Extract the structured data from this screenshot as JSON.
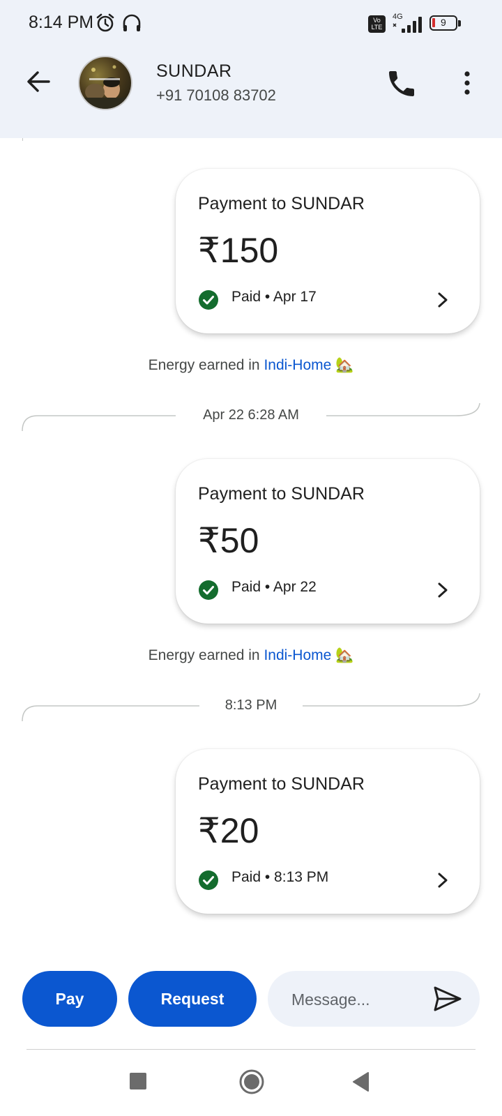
{
  "status_bar": {
    "time": "8:14 PM",
    "battery": "9",
    "network": "4G",
    "volte": "Vo LTE"
  },
  "header": {
    "name": "SUNDAR",
    "phone": "+91 70108 83702"
  },
  "payments": [
    {
      "title": "Payment to SUNDAR",
      "amount": "₹150",
      "status": "Paid • Apr 17"
    },
    {
      "title": "Payment to SUNDAR",
      "amount": "₹50",
      "status": "Paid • Apr 22"
    },
    {
      "title": "Payment to SUNDAR",
      "amount": "₹20",
      "status": "Paid • 8:13 PM"
    }
  ],
  "energy": {
    "prefix": "Energy earned in ",
    "link": "Indi-Home",
    "emoji": "🏡"
  },
  "separators": [
    "Apr 22 6:28 AM",
    "8:13 PM"
  ],
  "composer": {
    "pay_label": "Pay",
    "request_label": "Request",
    "message_placeholder": "Message..."
  },
  "colors": {
    "accent": "#0b57d0",
    "header_bg": "#eef2f9",
    "paid_green": "#146c2e"
  }
}
